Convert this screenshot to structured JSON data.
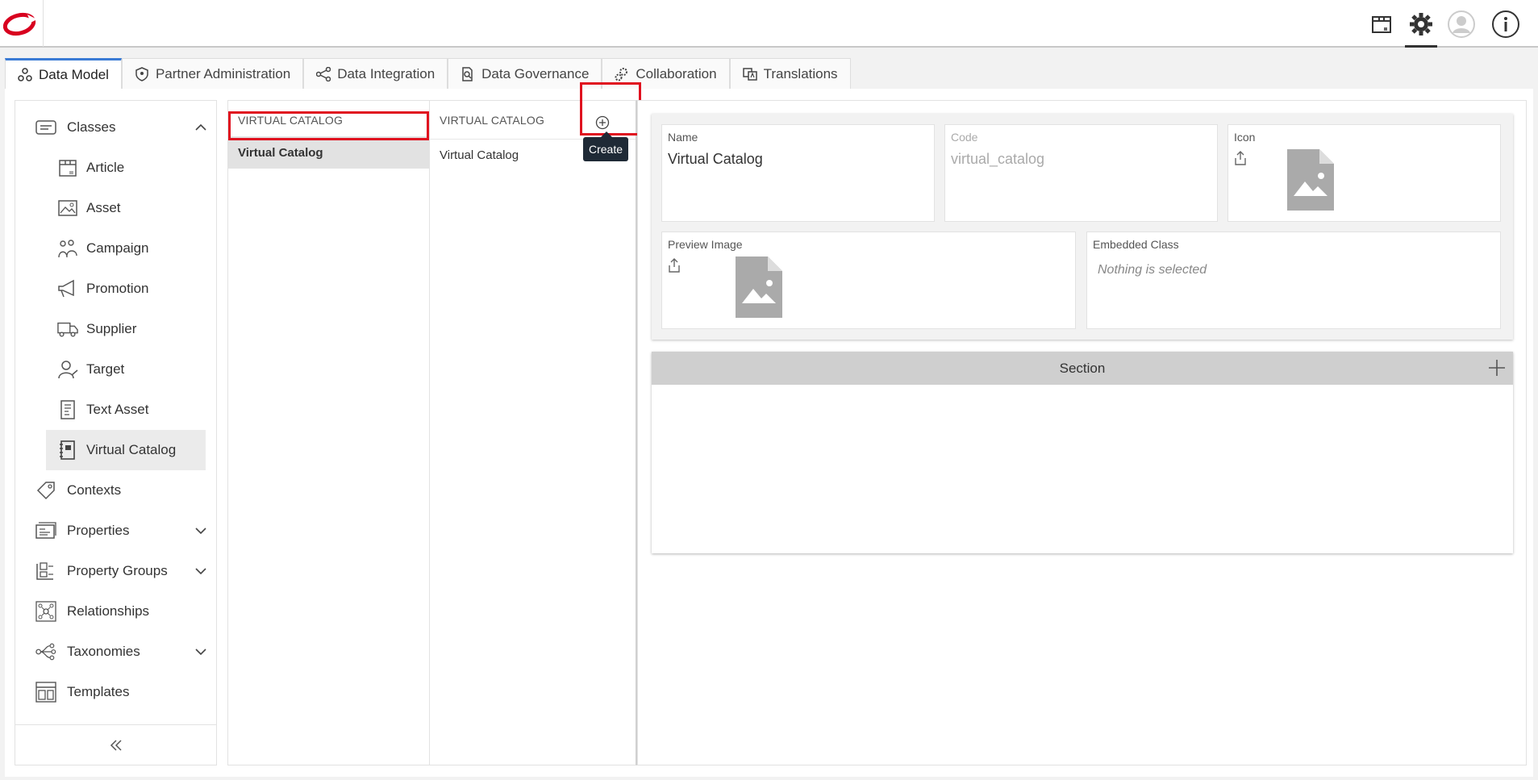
{
  "topbar": {
    "icons": [
      "logo-icon",
      "package-icon",
      "gear-icon",
      "user-avatar-icon",
      "info-icon"
    ]
  },
  "tabs": [
    {
      "label": "Data Model",
      "icon": "data-model-icon",
      "active": true
    },
    {
      "label": "Partner Administration",
      "icon": "shield-icon"
    },
    {
      "label": "Data Integration",
      "icon": "share-nodes-icon"
    },
    {
      "label": "Data Governance",
      "icon": "document-search-icon"
    },
    {
      "label": "Collaboration",
      "icon": "gears-icon"
    },
    {
      "label": "Translations",
      "icon": "translate-icon"
    }
  ],
  "nav": {
    "items": [
      {
        "label": "Classes",
        "icon": "classes-icon",
        "expanded": true
      },
      {
        "label": "Article",
        "icon": "article-icon"
      },
      {
        "label": "Asset",
        "icon": "asset-icon"
      },
      {
        "label": "Campaign",
        "icon": "campaign-icon"
      },
      {
        "label": "Promotion",
        "icon": "megaphone-icon"
      },
      {
        "label": "Supplier",
        "icon": "truck-icon"
      },
      {
        "label": "Target",
        "icon": "target-person-icon"
      },
      {
        "label": "Text Asset",
        "icon": "text-asset-icon"
      },
      {
        "label": "Virtual Catalog",
        "icon": "virtual-catalog-icon",
        "selected": true
      },
      {
        "label": "Contexts",
        "icon": "tag-icon"
      },
      {
        "label": "Properties",
        "icon": "properties-icon",
        "expandable": true
      },
      {
        "label": "Property Groups",
        "icon": "property-groups-icon",
        "expandable": true
      },
      {
        "label": "Relationships",
        "icon": "relationships-icon"
      },
      {
        "label": "Taxonomies",
        "icon": "taxonomies-icon",
        "expandable": true
      },
      {
        "label": "Templates",
        "icon": "templates-icon"
      }
    ],
    "collapse_icon": "double-chevron-left-icon"
  },
  "col1": {
    "header": "VIRTUAL CATALOG",
    "rows": [
      "Virtual Catalog"
    ]
  },
  "col2": {
    "header": "VIRTUAL CATALOG",
    "rows": [
      "Virtual Catalog"
    ],
    "create_tooltip": "Create"
  },
  "detail": {
    "name_label": "Name",
    "name_value": "Virtual Catalog",
    "code_label": "Code",
    "code_value": "virtual_catalog",
    "icon_label": "Icon",
    "preview_label": "Preview Image",
    "embedded_label": "Embedded Class",
    "embedded_placeholder": "Nothing is selected",
    "section_title": "Section"
  },
  "colors": {
    "accent": "#3a7bd5",
    "highlight": "#e0101f",
    "tooltip_bg": "#1f2a36",
    "logo_red": "#d8001f"
  }
}
